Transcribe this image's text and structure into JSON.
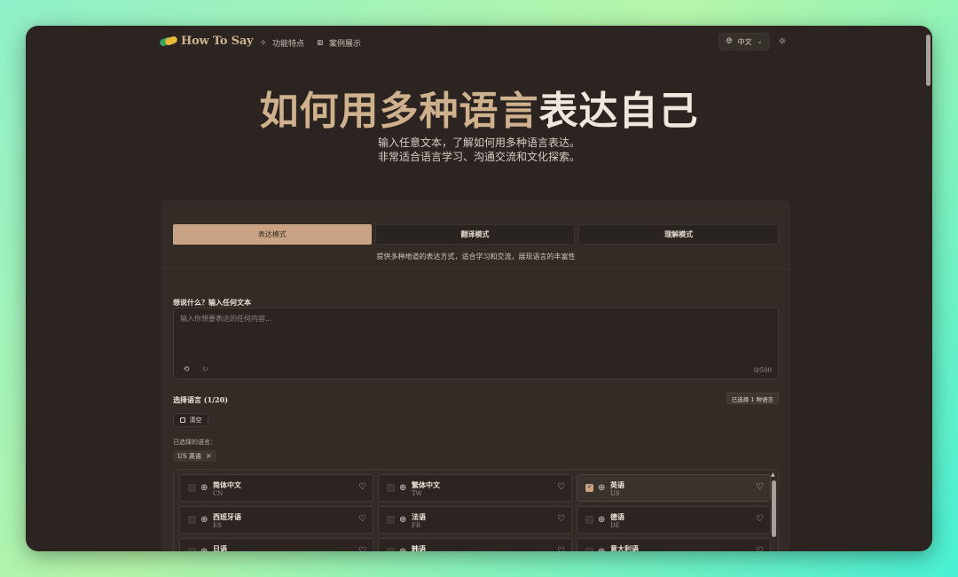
{
  "nav": {
    "logo_text": "How To Say",
    "links": [
      {
        "label": "功能特点",
        "icon": "sparkles-icon"
      },
      {
        "label": "案例展示",
        "icon": "grid-icon"
      }
    ],
    "language_button": "中文",
    "theme_icon": "sun-icon"
  },
  "hero": {
    "title_part1": "如何用多种语言",
    "title_part2": "表达自己",
    "subtitle_line1": "输入任意文本，了解如何用多种语言表达。",
    "subtitle_line2": "非常适合语言学习、沟通交流和文化探索。"
  },
  "modes": {
    "tabs": [
      "表达模式",
      "翻译模式",
      "理解模式"
    ],
    "active_index": 0,
    "description": "提供多种地道的表达方式，适合学习和交流，展现语言的丰富性"
  },
  "input": {
    "label": "想说什么？输入任何文本",
    "placeholder": "输入你想要表达的任何内容...",
    "counter": "0/500"
  },
  "languages": {
    "title": "选择语言 (1/20)",
    "selected_badge": "已选择 1 种语言",
    "clear_label": "清空",
    "chosen_label": "已选择的语言：",
    "chips": [
      "US 英语"
    ],
    "items": [
      {
        "name": "简体中文",
        "code": "CN",
        "selected": false
      },
      {
        "name": "繁体中文",
        "code": "TW",
        "selected": false
      },
      {
        "name": "英语",
        "code": "US",
        "selected": true
      },
      {
        "name": "西班牙语",
        "code": "ES",
        "selected": false
      },
      {
        "name": "法语",
        "code": "FR",
        "selected": false
      },
      {
        "name": "德语",
        "code": "DE",
        "selected": false
      },
      {
        "name": "日语",
        "code": "",
        "selected": false
      },
      {
        "name": "韩语",
        "code": "",
        "selected": false
      },
      {
        "name": "意大利语",
        "code": "",
        "selected": false
      }
    ]
  },
  "colors": {
    "accent": "#c9a383",
    "background": "#2b2420",
    "panel": "#322b26"
  }
}
